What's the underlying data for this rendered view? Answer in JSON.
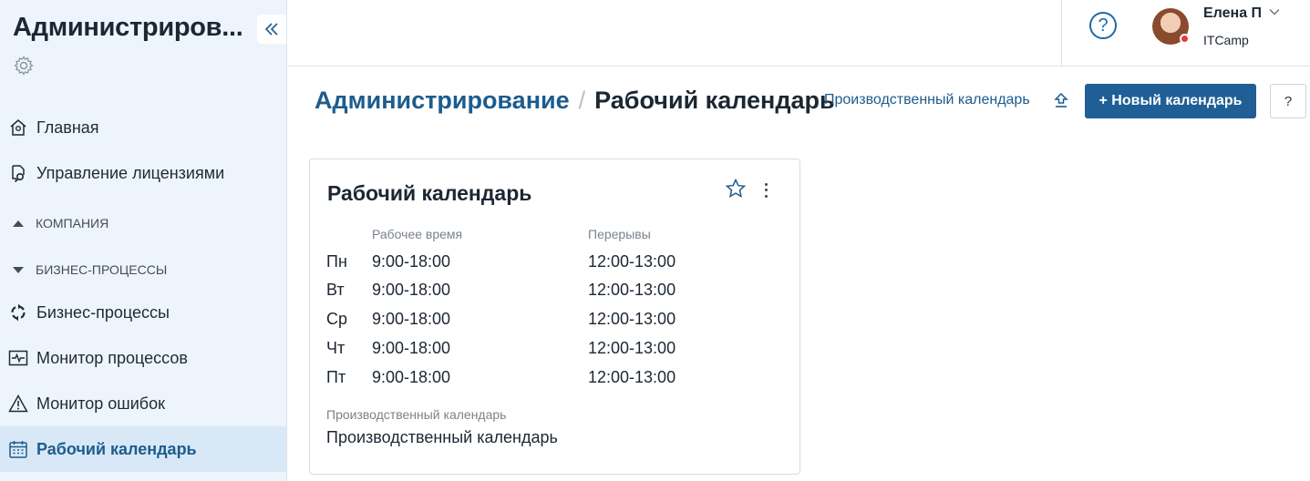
{
  "sidebar": {
    "app_title": "Администриров...",
    "items": [
      {
        "label": "Главная"
      },
      {
        "label": "Управление лицензиями"
      },
      {
        "label": "Бизнес-процессы"
      },
      {
        "label": "Монитор процессов"
      },
      {
        "label": "Монитор ошибок"
      },
      {
        "label": "Рабочий календарь"
      }
    ],
    "groups": [
      {
        "label": "КОМПАНИЯ"
      },
      {
        "label": "БИЗНЕС-ПРОЦЕССЫ"
      }
    ]
  },
  "topbar": {
    "user_name": "Елена П",
    "user_org": "ITCamp",
    "help_glyph": "?"
  },
  "header": {
    "breadcrumb_root": "Администрирование",
    "breadcrumb_sep": "/",
    "breadcrumb_current": "Рабочий календарь",
    "production_link": "Производственный календарь",
    "new_button": "+ Новый календарь",
    "help_glyph": "?"
  },
  "card": {
    "title": "Рабочий календарь",
    "col_work": "Рабочее время",
    "col_breaks": "Перерывы",
    "rows": [
      {
        "day": "Пн",
        "work": "9:00-18:00",
        "breaks": "12:00-13:00"
      },
      {
        "day": "Вт",
        "work": "9:00-18:00",
        "breaks": "12:00-13:00"
      },
      {
        "day": "Ср",
        "work": "9:00-18:00",
        "breaks": "12:00-13:00"
      },
      {
        "day": "Чт",
        "work": "9:00-18:00",
        "breaks": "12:00-13:00"
      },
      {
        "day": "Пт",
        "work": "9:00-18:00",
        "breaks": "12:00-13:00"
      }
    ],
    "production_label": "Производственный календарь",
    "production_value": "Производственный календарь"
  },
  "colors": {
    "accent": "#1d5c8e",
    "button": "#1f5f96",
    "sidebar_bg": "#eef4fb",
    "active_bg": "#d8e8f6",
    "status_dot": "#e53935"
  }
}
